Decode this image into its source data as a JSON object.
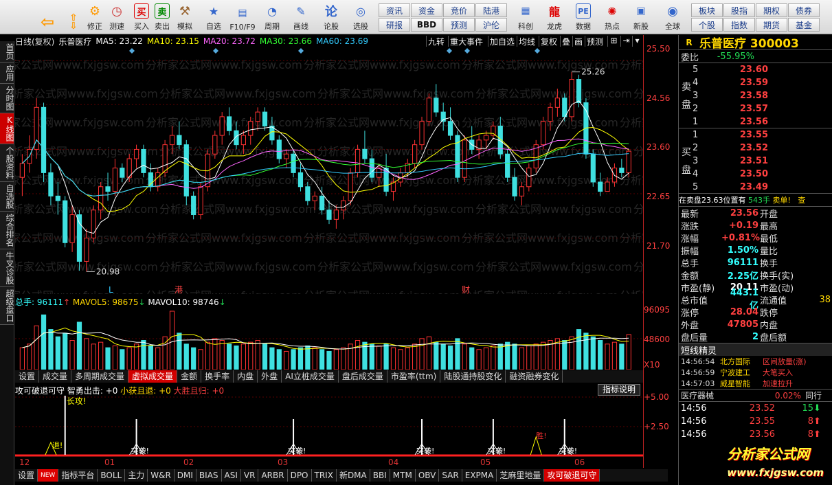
{
  "toolbar": {
    "buttons": [
      {
        "label": "",
        "icon": "windows-logo-icon"
      },
      {
        "label": "",
        "icon": "back-arrow-icon"
      },
      {
        "label": "",
        "icon": "updown-arrow-icon"
      },
      {
        "label": "修正",
        "icon": "fix-icon"
      },
      {
        "label": "测速",
        "icon": "clock-icon"
      },
      {
        "label": "买入",
        "icon": "buy-icon"
      },
      {
        "label": "卖出",
        "icon": "sell-icon"
      },
      {
        "label": "模拟",
        "icon": "hammer-icon"
      },
      {
        "label": "自选",
        "icon": "star-icon"
      },
      {
        "label": "F10/F9",
        "icon": "f10-icon"
      },
      {
        "label": "周期",
        "icon": "period-icon"
      },
      {
        "label": "画线",
        "icon": "pencil-icon"
      },
      {
        "label": "论股",
        "icon": "discuss-icon"
      },
      {
        "label": "选股",
        "icon": "select-stock-icon"
      }
    ],
    "grid_buttons": [
      [
        "资讯",
        "资金",
        "竞价",
        "陆港"
      ],
      [
        "研报",
        "BBD",
        "预测",
        "沪伦"
      ]
    ],
    "right_buttons": [
      {
        "label": "科创"
      },
      {
        "label": "龙虎"
      },
      {
        "label": "数据"
      },
      {
        "label": "热点"
      },
      {
        "label": "新股"
      },
      {
        "label": "全球"
      }
    ],
    "right_grid": [
      [
        "板块",
        "股指",
        "期权",
        "债券"
      ],
      [
        "个股",
        "指数",
        "期货",
        "基金"
      ]
    ]
  },
  "sidebar_tabs": [
    "首页",
    "应用",
    "分时图",
    "K线图",
    "个股资料",
    "自选股",
    "综合排名",
    "牛叉诊股",
    "超级盘口"
  ],
  "chart_header": {
    "period": "日线(复权)",
    "stock_name": "乐普医疗",
    "ma5": "MA5: 23.22",
    "ma10": "MA10: 23.15",
    "ma20": "MA20: 23.72",
    "ma30": "MA30: 23.66",
    "ma60": "MA60: 23.69",
    "buttons": [
      "九转",
      "重大事件",
      "加自选",
      "均线",
      "复权",
      "叠",
      "画",
      "预测"
    ]
  },
  "annotations": {
    "high": "25.26",
    "low": "20.98",
    "marks": [
      "L",
      "港",
      "财"
    ]
  },
  "y_axis": {
    "price_ticks": [
      "25.50",
      "24.56",
      "23.60",
      "22.65",
      "21.70"
    ],
    "vol_ticks": [
      "96095",
      "48600",
      "X10"
    ],
    "ind_ticks": [
      "+5.00",
      "+2.50"
    ]
  },
  "volume_header": {
    "total": "总手: 96111",
    "mavol5": "MAVOL5: 98675",
    "mavol10": "MAVOL10: 98746"
  },
  "tabs_mid": [
    "设置",
    "成交量",
    "多周期成交量",
    "虚拟成交量",
    "金额",
    "换手率",
    "内盘",
    "外盘",
    "AI立桩成交量",
    "盘后成交量",
    "市盈率(ttm)",
    "陆股通持股变化",
    "融资融券变化"
  ],
  "tabs_mid_active": "虚拟成交量",
  "indicator_header": {
    "name": "攻可破退可守",
    "z1": "智勇出击: +0",
    "z2": "小获且退: +0",
    "z3": "大胜且归: +0",
    "help": "指标说明"
  },
  "ind_labels": {
    "attack": "长攻!",
    "retreat": "退!",
    "sprint": "突袭!",
    "win": "胜!"
  },
  "dates": [
    "12",
    "01",
    "02",
    "03",
    "04",
    "05",
    "06"
  ],
  "tabs_bottom": [
    "设置",
    "NEW",
    "指标平台",
    "BOLL",
    "主力",
    "W&R",
    "DMI",
    "BIAS",
    "ASI",
    "VR",
    "ARBR",
    "DPO",
    "TRIX",
    "新DMA",
    "BBI",
    "MTM",
    "OBV",
    "SAR",
    "EXPMA",
    "芝麻里地量",
    "攻可破退可守"
  ],
  "right_panel": {
    "flag": "R",
    "stock_title": "乐普医疗 300003",
    "weibi_label": "委比",
    "weibi_value": "-55.95%",
    "sell_label": [
      "卖",
      "盘"
    ],
    "sells": [
      {
        "lvl": "5",
        "price": "23.60"
      },
      {
        "lvl": "4",
        "price": "23.59"
      },
      {
        "lvl": "3",
        "price": "23.58"
      },
      {
        "lvl": "2",
        "price": "23.57"
      },
      {
        "lvl": "1",
        "price": "23.56"
      }
    ],
    "buy_label": [
      "买",
      "盘"
    ],
    "buys": [
      {
        "lvl": "1",
        "price": "23.55"
      },
      {
        "lvl": "2",
        "price": "23.52"
      },
      {
        "lvl": "3",
        "price": "23.51"
      },
      {
        "lvl": "4",
        "price": "23.50"
      },
      {
        "lvl": "5",
        "price": "23.49"
      }
    ],
    "notice": "在卖盘23.63位置有",
    "notice_qty": "543手",
    "notice_act": "卖单!",
    "notice_tail": "查",
    "quote": [
      {
        "l": "最新",
        "v": "23.56",
        "l2": "开盘",
        "c": "red"
      },
      {
        "l": "涨跌",
        "v": "+0.19",
        "l2": "最高",
        "c": "red"
      },
      {
        "l": "涨幅",
        "v": "+0.81%",
        "l2": "最低",
        "c": "red"
      },
      {
        "l": "振幅",
        "v": "1.50%",
        "l2": "量比",
        "c": "cyan"
      },
      {
        "l": "总手",
        "v": "96111",
        "l2": "换手",
        "c": "cyan"
      },
      {
        "l": "金额",
        "v": "2.25亿",
        "l2": "换手(实)",
        "c": "cyan"
      },
      {
        "l": "市盈(静)",
        "v": "20.11",
        "l2": "市盈(动)",
        "c": "white"
      },
      {
        "l": "总市值",
        "v": "443.1亿",
        "l2": "流通值",
        "c": "cyan"
      },
      {
        "l": "涨停",
        "v": "28.04",
        "l2": "跌停",
        "c": "red"
      },
      {
        "l": "外盘",
        "v": "47805",
        "l2": "内盘",
        "c": "red"
      },
      {
        "l": "盘后量",
        "v": "2",
        "l2": "盘后额",
        "c": "cyan"
      }
    ],
    "liutongzhi_tail": "38",
    "short_title": "短线精灵",
    "short_items": [
      {
        "t": "14:56:54",
        "n": "北方国际",
        "e": "区间放量(涨)"
      },
      {
        "t": "14:56:59",
        "n": "宁波建工",
        "e": "大笔买入"
      },
      {
        "t": "14:57:03",
        "n": "威星智能",
        "e": "加速拉升"
      }
    ],
    "sector_name": "医疗器械",
    "sector_pct": "0.02%",
    "sector_btn": "同行",
    "ticks": [
      {
        "t": "14:56",
        "p": "23.52",
        "q": "15",
        "d": "down"
      },
      {
        "t": "14:56",
        "p": "23.55",
        "q": "8",
        "d": "up"
      },
      {
        "t": "14:56",
        "p": "23.56",
        "q": "8",
        "d": "up"
      }
    ]
  },
  "watermark": "分析家公式网",
  "watermark_url": "www.fxjgsw.com",
  "bg_watermark": "分析家公式网www.fxjgsw.com",
  "chart_data": {
    "type": "candlestick",
    "ylim": [
      20.5,
      25.8
    ],
    "candles": [
      [
        23.0,
        23.5,
        22.6,
        23.3
      ],
      [
        23.3,
        23.9,
        23.1,
        23.6
      ],
      [
        23.6,
        24.7,
        23.4,
        24.5
      ],
      [
        24.5,
        24.6,
        22.9,
        23.1
      ],
      [
        23.1,
        23.3,
        22.4,
        22.6
      ],
      [
        22.6,
        22.9,
        22.2,
        22.5
      ],
      [
        22.5,
        22.6,
        21.5,
        21.6
      ],
      [
        21.6,
        22.4,
        21.4,
        22.2
      ],
      [
        22.2,
        22.3,
        21.0,
        21.2
      ],
      [
        21.2,
        21.9,
        20.98,
        21.7
      ],
      [
        21.7,
        22.4,
        21.6,
        22.3
      ],
      [
        22.3,
        22.9,
        22.1,
        22.8
      ],
      [
        22.8,
        23.1,
        22.5,
        22.7
      ],
      [
        22.7,
        23.4,
        22.6,
        23.2
      ],
      [
        23.2,
        23.3,
        22.9,
        23.0
      ],
      [
        23.0,
        23.5,
        22.9,
        23.4
      ],
      [
        23.4,
        23.7,
        23.2,
        23.6
      ],
      [
        23.6,
        23.7,
        23.0,
        23.1
      ],
      [
        23.1,
        23.3,
        22.7,
        22.8
      ],
      [
        22.8,
        23.2,
        22.7,
        23.1
      ],
      [
        23.1,
        23.8,
        23.0,
        23.7
      ],
      [
        23.7,
        24.1,
        23.5,
        23.9
      ],
      [
        23.9,
        24.2,
        23.6,
        23.7
      ],
      [
        23.7,
        23.8,
        22.4,
        22.6
      ],
      [
        22.6,
        22.7,
        22.1,
        22.2
      ],
      [
        22.2,
        22.9,
        22.1,
        22.8
      ],
      [
        22.8,
        23.6,
        22.7,
        23.5
      ],
      [
        23.5,
        24.0,
        23.4,
        23.9
      ],
      [
        23.9,
        24.4,
        23.7,
        24.3
      ],
      [
        24.3,
        24.5,
        23.9,
        24.0
      ],
      [
        24.0,
        24.2,
        23.6,
        23.7
      ],
      [
        23.7,
        24.0,
        23.5,
        23.9
      ],
      [
        23.9,
        24.3,
        23.7,
        24.2
      ],
      [
        24.2,
        24.5,
        24.0,
        24.4
      ],
      [
        24.4,
        24.5,
        24.0,
        24.1
      ],
      [
        24.1,
        24.3,
        23.7,
        23.8
      ],
      [
        23.8,
        23.9,
        23.3,
        23.4
      ],
      [
        23.4,
        23.6,
        23.2,
        23.5
      ],
      [
        23.5,
        23.6,
        23.0,
        23.1
      ],
      [
        23.1,
        23.3,
        22.7,
        22.8
      ],
      [
        22.8,
        22.9,
        22.4,
        22.5
      ],
      [
        22.5,
        22.7,
        22.3,
        22.6
      ],
      [
        22.6,
        22.8,
        22.2,
        22.3
      ],
      [
        22.3,
        22.5,
        22.0,
        22.1
      ],
      [
        22.1,
        22.4,
        21.9,
        22.3
      ],
      [
        22.3,
        22.6,
        22.1,
        22.5
      ],
      [
        22.5,
        23.2,
        22.4,
        23.1
      ],
      [
        23.1,
        23.7,
        23.0,
        23.6
      ],
      [
        23.6,
        24.0,
        23.3,
        23.4
      ],
      [
        23.4,
        23.6,
        22.9,
        23.0
      ],
      [
        23.0,
        23.3,
        22.8,
        23.2
      ],
      [
        23.2,
        23.5,
        22.6,
        22.7
      ],
      [
        22.7,
        23.0,
        22.5,
        22.9
      ],
      [
        22.9,
        23.2,
        22.8,
        23.1
      ],
      [
        23.1,
        23.4,
        23.0,
        23.3
      ],
      [
        23.3,
        23.8,
        23.2,
        23.7
      ],
      [
        23.7,
        24.3,
        23.6,
        24.2
      ],
      [
        24.2,
        24.8,
        24.1,
        24.7
      ],
      [
        24.7,
        25.0,
        24.3,
        24.4
      ],
      [
        24.4,
        24.6,
        24.0,
        24.2
      ],
      [
        24.2,
        24.5,
        23.8,
        23.9
      ],
      [
        23.9,
        24.0,
        22.9,
        23.0
      ],
      [
        23.0,
        23.9,
        22.9,
        23.8
      ],
      [
        23.8,
        24.1,
        23.5,
        23.6
      ],
      [
        23.6,
        23.9,
        23.4,
        23.8
      ],
      [
        23.8,
        24.0,
        23.6,
        23.9
      ],
      [
        23.9,
        24.2,
        23.8,
        24.1
      ],
      [
        24.1,
        24.3,
        23.4,
        23.5
      ],
      [
        23.5,
        23.6,
        22.9,
        23.0
      ],
      [
        23.0,
        23.2,
        22.5,
        22.6
      ],
      [
        22.6,
        22.9,
        22.4,
        22.8
      ],
      [
        22.8,
        23.3,
        22.7,
        23.2
      ],
      [
        23.2,
        23.8,
        23.1,
        23.7
      ],
      [
        23.7,
        24.3,
        23.6,
        24.2
      ],
      [
        24.2,
        24.6,
        24.0,
        24.5
      ],
      [
        24.5,
        24.9,
        24.3,
        24.7
      ],
      [
        24.7,
        24.8,
        24.2,
        24.3
      ],
      [
        24.3,
        25.26,
        24.2,
        25.1
      ],
      [
        25.1,
        25.2,
        24.5,
        24.6
      ],
      [
        24.6,
        24.7,
        23.4,
        23.5
      ],
      [
        23.5,
        23.6,
        22.8,
        22.9
      ],
      [
        22.9,
        23.1,
        22.6,
        22.7
      ],
      [
        22.7,
        23.0,
        22.7,
        22.9
      ],
      [
        22.9,
        23.3,
        22.8,
        23.2
      ],
      [
        23.2,
        23.4,
        23.0,
        23.1
      ],
      [
        23.1,
        23.6,
        23.0,
        23.56
      ]
    ],
    "volumes": [
      60,
      70,
      120,
      150,
      110,
      90,
      100,
      80,
      130,
      85,
      70,
      75,
      60,
      65,
      55,
      60,
      70,
      80,
      65,
      60,
      90,
      160,
      100,
      70,
      60,
      55,
      75,
      85,
      80,
      70,
      65,
      70,
      75,
      80,
      70,
      60,
      55,
      50,
      55,
      60,
      65,
      60,
      55,
      50,
      55,
      60,
      70,
      80,
      75,
      70,
      65,
      70,
      60,
      55,
      60,
      70,
      85,
      90,
      75,
      70,
      65,
      85,
      70,
      60,
      55,
      60,
      65,
      70,
      75,
      70,
      60,
      65,
      70,
      75,
      80,
      85,
      80,
      90,
      110,
      100,
      90,
      80,
      70,
      75,
      70,
      96
    ],
    "ma_series": [
      {
        "name": "MA5",
        "color": "#ffffff"
      },
      {
        "name": "MA10",
        "color": "#ffff00"
      },
      {
        "name": "MA20",
        "color": "#ff66ff"
      },
      {
        "name": "MA30",
        "color": "#33ff33"
      },
      {
        "name": "MA60",
        "color": "#33ccff"
      }
    ],
    "signals": [
      {
        "idx": 4,
        "kind": "retreat"
      },
      {
        "idx": 6,
        "kind": "attack"
      },
      {
        "idx": 16,
        "kind": "sprint"
      },
      {
        "idx": 38,
        "kind": "sprint"
      },
      {
        "idx": 56,
        "kind": "sprint"
      },
      {
        "idx": 66,
        "kind": "sprint"
      },
      {
        "idx": 72,
        "kind": "win"
      },
      {
        "idx": 76,
        "kind": "sprint"
      }
    ]
  }
}
